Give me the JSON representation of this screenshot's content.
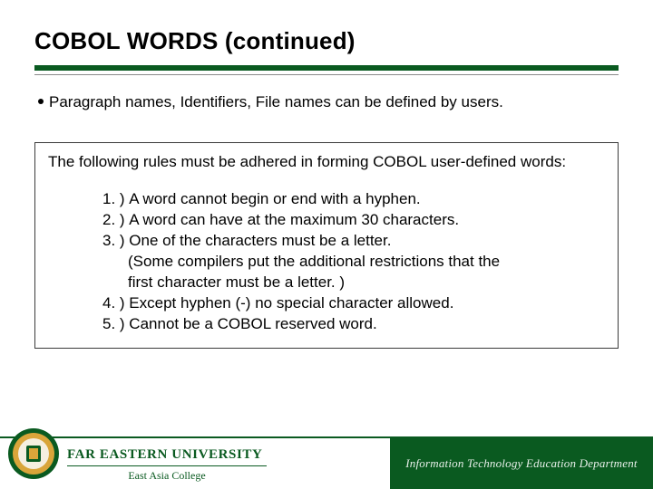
{
  "title": "COBOL WORDS (continued)",
  "bullet": "Paragraph names, Identifiers, File names can be defined by users.",
  "box": {
    "intro": "The following rules must be adhered in forming COBOL user-defined words:",
    "rules": [
      {
        "num": "1. ) ",
        "text": "A word cannot begin or end with a hyphen."
      },
      {
        "num": "2. ) ",
        "text": "A word can have at the maximum 30 characters."
      },
      {
        "num": "3. ) ",
        "text": "One of the characters must be a letter."
      },
      {
        "num": "",
        "text": "(Some compilers put the additional restrictions that the"
      },
      {
        "num": "",
        "text": "first character must be a letter. )"
      },
      {
        "num": "4. ) ",
        "text": "Except hyphen (-) no special character allowed."
      },
      {
        "num": "5. ) ",
        "text": "Cannot be a COBOL reserved word."
      }
    ]
  },
  "footer": {
    "university": "FAR EASTERN UNIVERSITY",
    "college": "East Asia College",
    "department": "Information Technology Education Department"
  },
  "colors": {
    "brand_green": "#0a5a20"
  }
}
